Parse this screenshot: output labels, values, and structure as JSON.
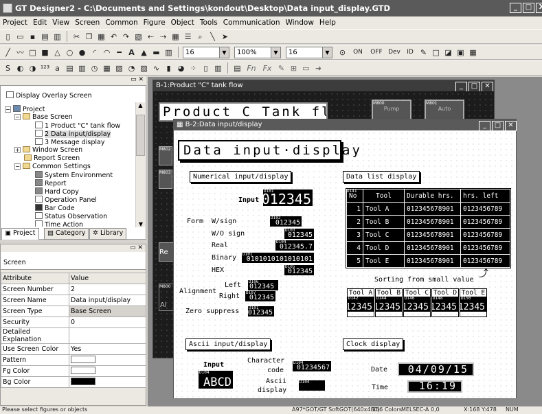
{
  "window": {
    "title": "GT Designer2 - C:\\Documents and Settings\\kondout\\Desktop\\Data input_display.GTD",
    "controls": [
      "_",
      "□",
      "X"
    ]
  },
  "menu": [
    "Project",
    "Edit",
    "View",
    "Screen",
    "Common",
    "Figure",
    "Object",
    "Tools",
    "Communication",
    "Window",
    "Help"
  ],
  "toolbar2": {
    "line_width": "16",
    "zoom": "100%",
    "font_size": "16",
    "on": "ON",
    "off": "OFF",
    "dev": "Dev",
    "id": "ID"
  },
  "toolbar3_text": [
    "Fn",
    "Fx"
  ],
  "project_panel": {
    "overlay_label": "Display Overlay Screen",
    "tree": [
      "Project",
      "Base Screen",
      "1 Product \"C\" tank flow",
      "2 Data input/display",
      "3 Message display",
      "Window Screen",
      "Report Screen",
      "Common Settings",
      "System Environment",
      "Report",
      "Hard Copy",
      "Operation Panel",
      "Bar Code",
      "Status Observation",
      "Time Action"
    ],
    "tabs": [
      "Project",
      "Category",
      "Library"
    ]
  },
  "screen_panel": {
    "title": "Screen",
    "headers": [
      "Attribute",
      "Value"
    ],
    "rows": [
      [
        "Screen Number",
        "2"
      ],
      [
        "Screen Name",
        "Data input/display"
      ],
      [
        "Screen Type",
        "Base Screen"
      ],
      [
        "Security",
        "0"
      ],
      [
        "Detailed Explanation",
        ""
      ],
      [
        "Use Screen Color",
        "Yes"
      ],
      [
        "Pattern",
        ""
      ],
      [
        "Fg Color",
        ""
      ],
      [
        "Bg Color",
        ""
      ]
    ]
  },
  "status_bar": {
    "hint": "Please select figures or objects",
    "model": "A97*GOT/GT SoftGOT(640x480)",
    "colors": "256 Colors",
    "plc": "MELSEC-A",
    "xy": "0,0",
    "cursor": "X:168 Y:478",
    "num": "NUM"
  },
  "b1": {
    "title": "B-1:Product \"C\" tank flow",
    "heading": "Product C Tank flow",
    "lamp1": "M800",
    "lamp1_text": "Pump",
    "lamp2": "M801",
    "lamp2_text": "Auto",
    "side_text": [
      "M802",
      "M803",
      "Re",
      "M800",
      "Al"
    ]
  },
  "b2": {
    "title": "B-2:Data input/display",
    "heading": "Data input·display",
    "numerical": {
      "title": "Numerical input/display",
      "input_label": "Input",
      "input_value": "012345",
      "input_dev": "D101",
      "form_label": "Form",
      "rows": [
        {
          "label": "W/sign",
          "dev": "D102",
          "value": "012345"
        },
        {
          "label": "W/O sign",
          "dev": "D103",
          "value": "012345"
        },
        {
          "label": "Real",
          "dev": "D104",
          "value": "012345.7"
        },
        {
          "label": "Binary",
          "dev": "D101",
          "value": "0101010101010101"
        },
        {
          "label": "HEX",
          "dev": "D105",
          "value": "012345"
        }
      ],
      "alignment_label": "Alignment",
      "left_label": "Left",
      "left_dev": "D106",
      "left_value": "012345",
      "right_label": "Right",
      "right_dev": "D107",
      "right_value": "012345",
      "zero_label": "Zero suppress",
      "zero_dev": "D101",
      "zero_value": "012345"
    },
    "datalist": {
      "title": "Data list display",
      "dev": "D141",
      "headers": [
        "No",
        "Tool",
        "Durable hrs.",
        "hrs. left"
      ],
      "rows": [
        [
          "1",
          "Tool A",
          "012345678901",
          "0123456789"
        ],
        [
          "2",
          "Tool B",
          "012345678901",
          "0123456789"
        ],
        [
          "3",
          "Tool C",
          "012345678901",
          "0123456789"
        ],
        [
          "4",
          "Tool D",
          "012345678901",
          "0123456789"
        ],
        [
          "5",
          "Tool E",
          "012345678901",
          "0123456789"
        ]
      ],
      "sort_label": "Sorting from small value",
      "tools": [
        {
          "name": "Tool A",
          "dev": "D142",
          "value": "012345"
        },
        {
          "name": "Tool B",
          "dev": "D144",
          "value": "012345"
        },
        {
          "name": "Tool C",
          "dev": "D146",
          "value": "012345"
        },
        {
          "name": "Tool D",
          "dev": "D148",
          "value": "012345"
        },
        {
          "name": "Tool E",
          "dev": "D150",
          "value": "012345"
        }
      ]
    },
    "ascii": {
      "title": "Ascii input/display",
      "input_label": "Input",
      "input_dev": "D104",
      "input_value": "ABCD",
      "char_label_1": "Character",
      "char_label_2": "code",
      "char_dev": "D104",
      "char_value": "01234567",
      "ascii_label_1": "Ascii",
      "ascii_label_2": "display",
      "ascii_dev": "D104",
      "ascii_value": ""
    },
    "clock": {
      "title": "Clock display",
      "date_label": "Date",
      "date_value": "04/09/15",
      "time_label": "Time",
      "time_value": "16:19"
    }
  }
}
